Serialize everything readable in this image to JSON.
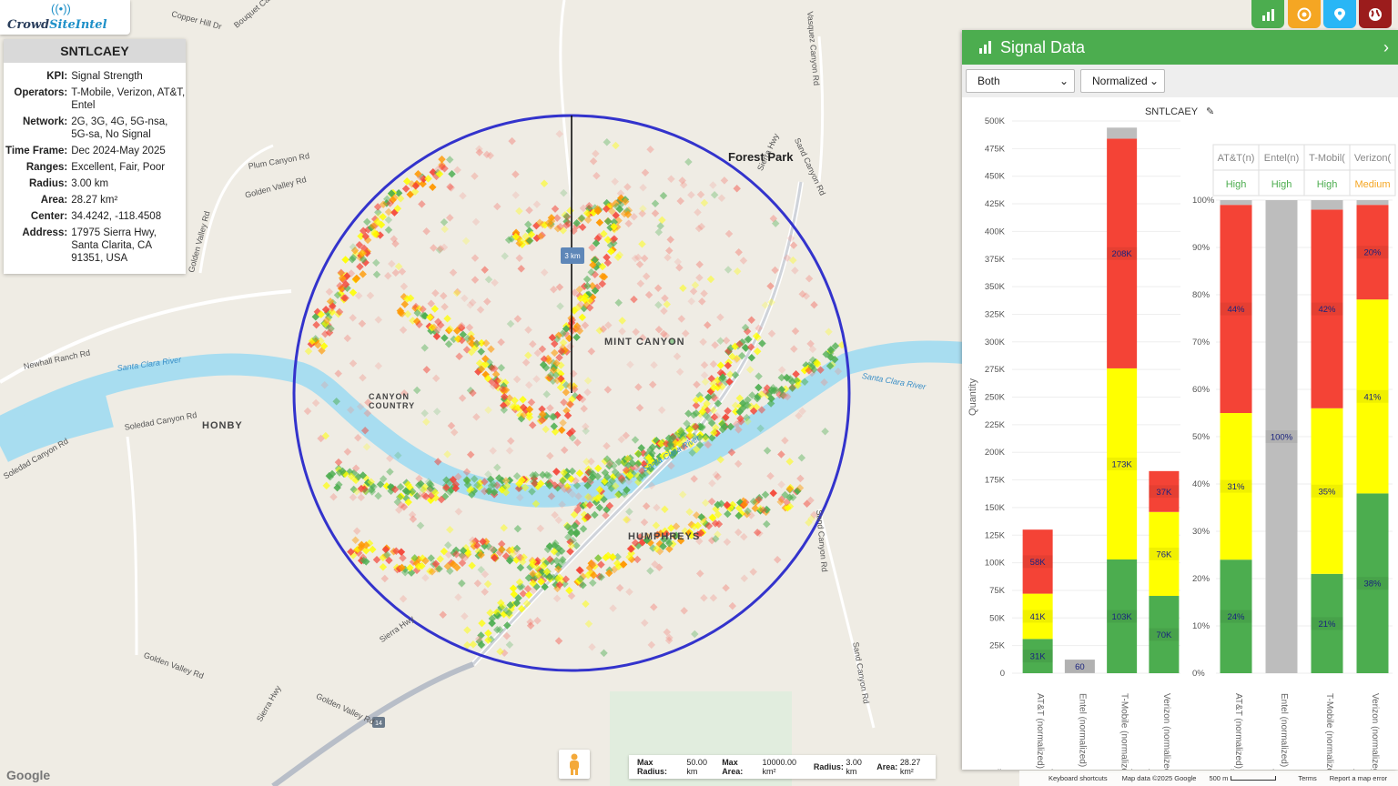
{
  "logo": {
    "brand_left": "Crowd",
    "brand_right": "SiteIntel"
  },
  "info": {
    "site": "SNTLCAEY",
    "rows": [
      {
        "k": "KPI:",
        "v": "Signal Strength"
      },
      {
        "k": "Operators:",
        "v": "T-Mobile, Verizon, AT&T, Entel"
      },
      {
        "k": "Network:",
        "v": "2G, 3G, 4G, 5G-nsa, 5G-sa, No Signal"
      },
      {
        "k": "Time Frame:",
        "v": "Dec 2024-May 2025"
      },
      {
        "k": "Ranges:",
        "v": "Excellent, Fair, Poor"
      },
      {
        "k": "Radius:",
        "v": "3.00 km"
      },
      {
        "k": "Area:",
        "v": "28.27 km²"
      },
      {
        "k": "Center:",
        "v": "34.4242, -118.4508"
      },
      {
        "k": "Address:",
        "v": "17975 Sierra Hwy, Santa Clarita, CA 91351, USA"
      }
    ]
  },
  "map": {
    "labels": [
      {
        "text": "Copper Hill Dr",
        "cls": ""
      },
      {
        "text": "Bouquet Canyon Rd",
        "cls": ""
      },
      {
        "text": "Vasquez Canyon Rd",
        "cls": ""
      },
      {
        "text": "Forest Park",
        "cls": "place"
      },
      {
        "text": "Sand Canyon Rd",
        "cls": ""
      },
      {
        "text": "Plum Canyon Rd",
        "cls": ""
      },
      {
        "text": "Golden Valley Rd",
        "cls": ""
      },
      {
        "text": "Newhall Ranch Rd",
        "cls": ""
      },
      {
        "text": "Santa Clara River",
        "cls": "river"
      },
      {
        "text": "Soledad Canyon Rd",
        "cls": ""
      },
      {
        "text": "HONBY",
        "cls": "town"
      },
      {
        "text": "CANYON COUNTRY",
        "cls": "town"
      },
      {
        "text": "MINT CANYON",
        "cls": "town"
      },
      {
        "text": "HUMPHREYS",
        "cls": "town"
      },
      {
        "text": "Sierra Hwy",
        "cls": ""
      },
      {
        "text": "Sierra Hwy",
        "cls": ""
      },
      {
        "text": "Sand Canyon Rd",
        "cls": ""
      },
      {
        "text": "Santa Clara River",
        "cls": "river"
      },
      {
        "text": "Santa Clara River",
        "cls": "river"
      },
      {
        "text": "Golden Valley Rd",
        "cls": ""
      },
      {
        "text": "Golden Valley Rd",
        "cls": ""
      },
      {
        "text": "Golden Valley Rd",
        "cls": ""
      },
      {
        "text": "Soledad Canyon Rd",
        "cls": ""
      },
      {
        "text": "Sand Canyon Rd",
        "cls": ""
      },
      {
        "text": "Sierra Hwy",
        "cls": ""
      }
    ],
    "ruler_label": "3 km",
    "highway_shield": "14",
    "max_radius_label": "Max Radius:",
    "max_radius": "50.00 km",
    "max_area_label": "Max Area:",
    "max_area": "10000.00 km²",
    "radius_label": "Radius:",
    "radius": "3.00 km",
    "area_label": "Area:",
    "area": "28.27 km²"
  },
  "footer": {
    "google": "Google",
    "shortcuts": "Keyboard shortcuts",
    "map_data": "Map data ©2025 Google",
    "scale": "500 m",
    "terms": "Terms",
    "report": "Report a map error"
  },
  "top_buttons": [
    {
      "icon": "bar-chart-icon",
      "color": "#4cad4f"
    },
    {
      "icon": "target-icon",
      "color": "#f5a623"
    },
    {
      "icon": "map-pin-icon",
      "color": "#29b6f6"
    },
    {
      "icon": "globe-icon",
      "color": "#9b1c1c"
    }
  ],
  "panel": {
    "title": "Signal Data",
    "select_mode": "Both",
    "select_scale": "Normalized",
    "site": "SNTLCAEY"
  },
  "colors": {
    "excellent": "#4cad4f",
    "fair": "#ffff00",
    "poor": "#f44336",
    "no_signal": "#bdbdbd",
    "circle": "#3333cc"
  },
  "chart_data": [
    {
      "type": "bar",
      "stacked": true,
      "ylabel": "Quantity",
      "ylim": [
        0,
        500000
      ],
      "yticks": [
        "0",
        "25K",
        "50K",
        "75K",
        "100K",
        "125K",
        "150K",
        "175K",
        "200K",
        "225K",
        "250K",
        "275K",
        "300K",
        "325K",
        "350K",
        "375K",
        "400K",
        "425K",
        "450K",
        "475K",
        "500K"
      ],
      "categories": [
        "AT&T (normalized)",
        "Entel (normalized)",
        "T-Mobile (normalized)",
        "Verizon (normalized)"
      ],
      "series": [
        {
          "name": "Excellent",
          "values": [
            31000,
            0,
            103000,
            70000
          ],
          "labels": [
            "31K",
            "",
            "103K",
            "70K"
          ]
        },
        {
          "name": "Fair",
          "values": [
            41000,
            0,
            173000,
            76000
          ],
          "labels": [
            "41K",
            "",
            "173K",
            "76K"
          ]
        },
        {
          "name": "Poor",
          "values": [
            58000,
            0,
            208000,
            37000
          ],
          "labels": [
            "58K",
            "",
            "208K",
            "37K"
          ]
        },
        {
          "name": "No Signal",
          "values": [
            0,
            60,
            10000,
            0
          ],
          "labels": [
            "",
            "60",
            "",
            ""
          ]
        }
      ]
    },
    {
      "type": "bar",
      "stacked": true,
      "ylim": [
        0,
        100
      ],
      "yticks": [
        "0%",
        "10%",
        "20%",
        "30%",
        "40%",
        "50%",
        "60%",
        "70%",
        "80%",
        "90%",
        "100%"
      ],
      "categories": [
        "AT&T (normalized)",
        "Entel (normalized)",
        "T-Mobile (normalized)",
        "Verizon (normalized)"
      ],
      "column_headers": [
        "AT&T(n)",
        "Entel(n)",
        "T-Mobil(",
        "Verizon("
      ],
      "column_ratings": [
        "High",
        "High",
        "High",
        "Medium"
      ],
      "series": [
        {
          "name": "Excellent",
          "values": [
            24,
            0,
            21,
            38
          ],
          "labels": [
            "24%",
            "",
            "21%",
            "38%"
          ]
        },
        {
          "name": "Fair",
          "values": [
            31,
            0,
            35,
            41
          ],
          "labels": [
            "31%",
            "",
            "35%",
            "41%"
          ]
        },
        {
          "name": "Poor",
          "values": [
            44,
            0,
            42,
            20
          ],
          "labels": [
            "44%",
            "",
            "42%",
            "20%"
          ]
        },
        {
          "name": "No Signal",
          "values": [
            1,
            100,
            2,
            1
          ],
          "labels": [
            "",
            "100%",
            "",
            ""
          ]
        }
      ]
    }
  ],
  "legend": [
    "Excellent",
    "Fair",
    "Poor",
    "No Signal"
  ]
}
